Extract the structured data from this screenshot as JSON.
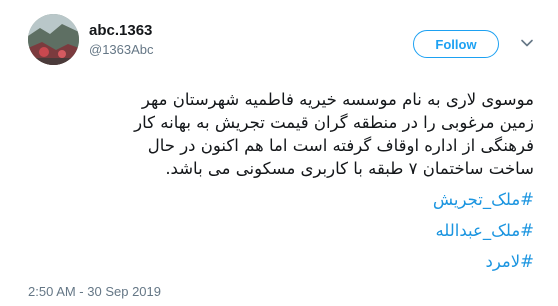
{
  "author": {
    "display_name": "abc.1363",
    "username": "@1363Abc"
  },
  "follow_button": {
    "label": "Follow"
  },
  "tweet": {
    "lines": [
      "موسوی لاری به نام موسسه خیریه فاطمیه شهرستان مهر",
      "زمین مرغوبی را در منطقه گران قیمت تجریش به بهانه کار",
      "فرهنگی از اداره اوقاف گرفته است اما هم اکنون در حال",
      "ساخت ساختمان ۷ طبقه با کاربری مسکونی می باشد."
    ],
    "hashtags": [
      "#ملک_تجریش",
      "#ملک_عبدالله",
      "#لامرد"
    ]
  },
  "timestamp": "2:50 AM - 30 Sep 2019",
  "colors": {
    "accent": "#1da1f2",
    "link": "#1b95e0",
    "secondary_text": "#657786"
  },
  "icons": {
    "menu": "chevron-down-icon"
  }
}
